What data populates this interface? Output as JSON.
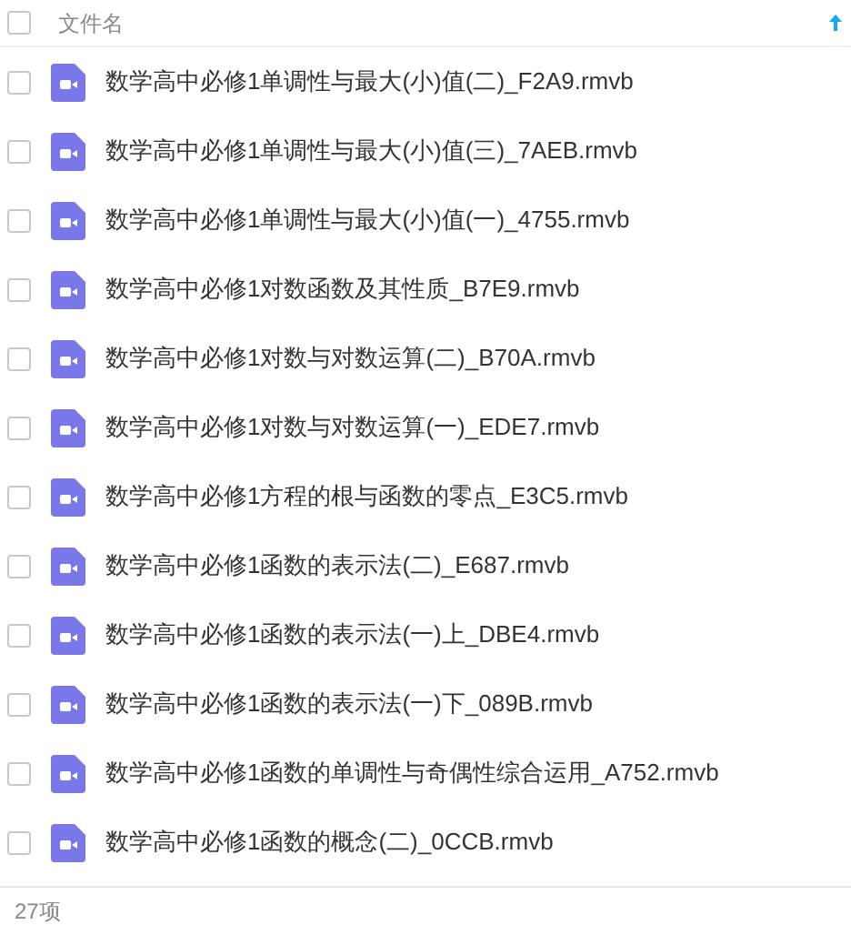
{
  "header": {
    "select_all": {
      "checked": false
    },
    "column": "文件名",
    "sort_ascending": true
  },
  "files": [
    {
      "name": "数学高中必修1单调性与最大(小)值(二)_F2A9.rmvb",
      "checked": false
    },
    {
      "name": "数学高中必修1单调性与最大(小)值(三)_7AEB.rmvb",
      "checked": false
    },
    {
      "name": "数学高中必修1单调性与最大(小)值(一)_4755.rmvb",
      "checked": false
    },
    {
      "name": "数学高中必修1对数函数及其性质_B7E9.rmvb",
      "checked": false
    },
    {
      "name": "数学高中必修1对数与对数运算(二)_B70A.rmvb",
      "checked": false
    },
    {
      "name": "数学高中必修1对数与对数运算(一)_EDE7.rmvb",
      "checked": false
    },
    {
      "name": "数学高中必修1方程的根与函数的零点_E3C5.rmvb",
      "checked": false
    },
    {
      "name": "数学高中必修1函数的表示法(二)_E687.rmvb",
      "checked": false
    },
    {
      "name": "数学高中必修1函数的表示法(一)上_DBE4.rmvb",
      "checked": false
    },
    {
      "name": "数学高中必修1函数的表示法(一)下_089B.rmvb",
      "checked": false
    },
    {
      "name": "数学高中必修1函数的单调性与奇偶性综合运用_A752.rmvb",
      "checked": false
    },
    {
      "name": "数学高中必修1函数的概念(二)_0CCB.rmvb",
      "checked": false
    }
  ],
  "status_bar": "27项"
}
